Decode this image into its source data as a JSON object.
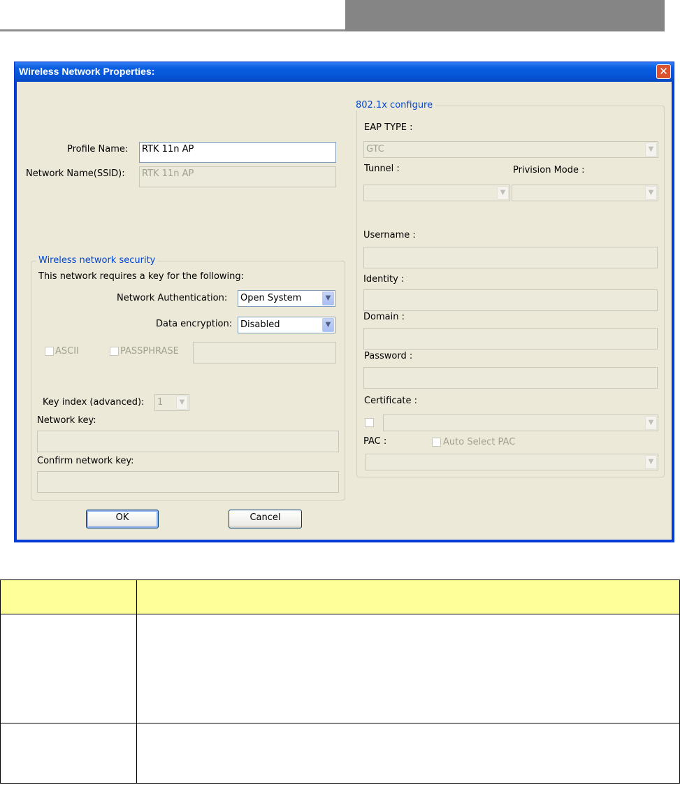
{
  "dialog": {
    "title": "Wireless Network Properties:",
    "close_glyph": "✕"
  },
  "profile": {
    "profile_name_label": "Profile Name:",
    "profile_name_value": "RTK 11n AP",
    "ssid_label": "Network Name(SSID):",
    "ssid_value": "RTK 11n AP"
  },
  "security": {
    "legend": "Wireless network security",
    "requires_key_text": "This network requires a key for the following:",
    "auth_label": "Network Authentication:",
    "auth_value": "Open System",
    "encryption_label": "Data encryption:",
    "encryption_value": "Disabled",
    "ascii_label": "ASCII",
    "passphrase_label": "PASSPHRASE",
    "passphrase_value": "",
    "key_index_label": "Key index (advanced):",
    "key_index_value": "1",
    "network_key_label": "Network key:",
    "network_key_value": "",
    "confirm_key_label": "Confirm network key:",
    "confirm_key_value": ""
  },
  "dot1x": {
    "legend": "802.1x configure",
    "eap_type_label": "EAP TYPE :",
    "eap_type_value": "GTC",
    "tunnel_label": "Tunnel :",
    "tunnel_value": "",
    "provision_label": "Privision Mode :",
    "provision_value": "",
    "username_label": "Username :",
    "username_value": "",
    "identity_label": "Identity :",
    "identity_value": "",
    "domain_label": "Domain :",
    "domain_value": "",
    "password_label": "Password :",
    "password_value": "",
    "certificate_label": "Certificate :",
    "certificate_value": "",
    "pac_label": "PAC :",
    "auto_pac_label": "Auto Select PAC",
    "pac_value": ""
  },
  "buttons": {
    "ok_label": "OK",
    "cancel_label": "Cancel"
  },
  "icons": {
    "dropdown": "▼",
    "close": "close-icon"
  },
  "colors": {
    "titlebar": "#0a5ee0",
    "dialog_face": "#ece9d8",
    "group_legend": "#0046d5",
    "table_header": "#ffff99",
    "header_bar": "#858585"
  }
}
